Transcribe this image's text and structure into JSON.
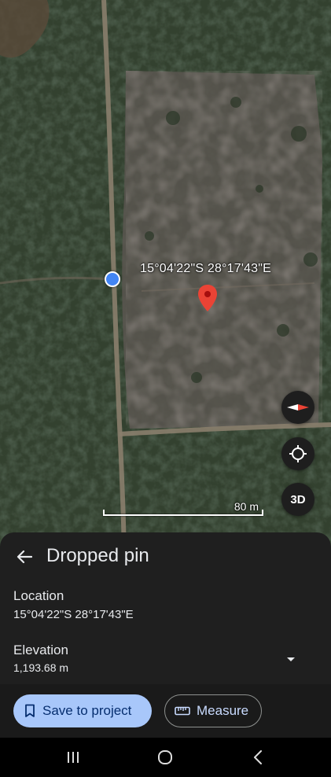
{
  "map": {
    "coordinates_label": "15°04'22\"S 28°17'43\"E",
    "scale_label": "80 m",
    "three_d_label": "3D",
    "pin_color": "#ea4335",
    "location_dot_color": "#4285f4"
  },
  "sheet": {
    "title": "Dropped pin",
    "location_label": "Location",
    "location_value": "15°04'22\"S 28°17'43\"E",
    "elevation_label": "Elevation",
    "elevation_value": "1,193.68 m"
  },
  "actions": {
    "save_label": "Save to project",
    "measure_label": "Measure"
  },
  "icons": {
    "back": "arrow-left-icon",
    "bookmark": "bookmark-icon",
    "ruler": "ruler-icon",
    "compass": "compass-icon",
    "locate": "crosshair-icon",
    "expand": "chevron-down-icon"
  },
  "colors": {
    "accent": "#a8c7fa",
    "sheet_background": "#1f1f1f"
  }
}
